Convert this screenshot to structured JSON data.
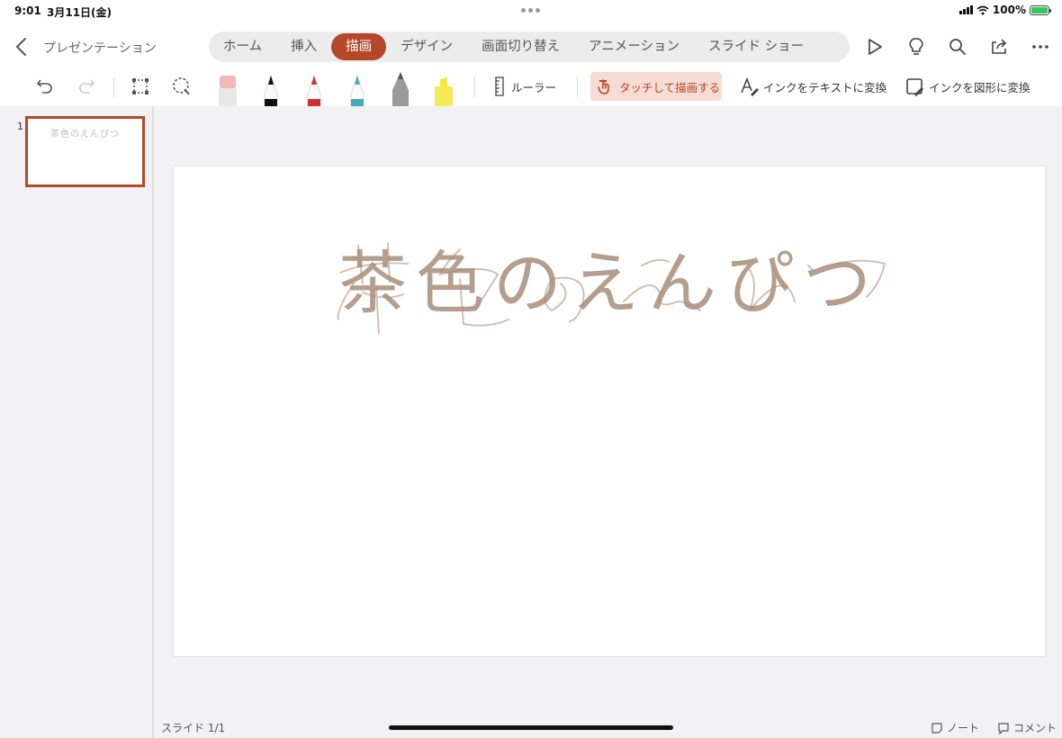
{
  "status": {
    "time": "9:01",
    "date": "3月11日(金)",
    "battery": "100%"
  },
  "header": {
    "doc_title": "プレゼンテーション"
  },
  "tabs": [
    {
      "label": "ホーム"
    },
    {
      "label": "挿入"
    },
    {
      "label": "描画",
      "active": true
    },
    {
      "label": "デザイン"
    },
    {
      "label": "画面切り替え"
    },
    {
      "label": "アニメーション"
    },
    {
      "label": "スライド ショー"
    }
  ],
  "toolbar": {
    "ruler_label": "ルーラー",
    "touch_draw_label": "タッチして描画する",
    "ink_to_text_label": "インクをテキストに変換",
    "ink_to_shape_label": "インクを図形に変換"
  },
  "pens": [
    {
      "name": "eraser",
      "color": "#f2b8b8"
    },
    {
      "name": "pen-black",
      "color": "#111111"
    },
    {
      "name": "pen-red",
      "color": "#d22f2f"
    },
    {
      "name": "pencil-teal",
      "color": "#4aa9b8"
    },
    {
      "name": "pencil-gray",
      "color": "#8a8a8a"
    },
    {
      "name": "highlighter-yellow",
      "color": "#f5e83a"
    }
  ],
  "slides_panel": {
    "items": [
      {
        "number": "1"
      }
    ]
  },
  "slide": {
    "ink_text": "茶色のえんぴつ",
    "ink_color": "#a88e7a"
  },
  "footer": {
    "slide_counter": "スライド 1/1",
    "notes_label": "ノート",
    "comments_label": "コメント"
  },
  "colors": {
    "accent": "#b7472a",
    "accent_light": "#f7dcd3"
  }
}
